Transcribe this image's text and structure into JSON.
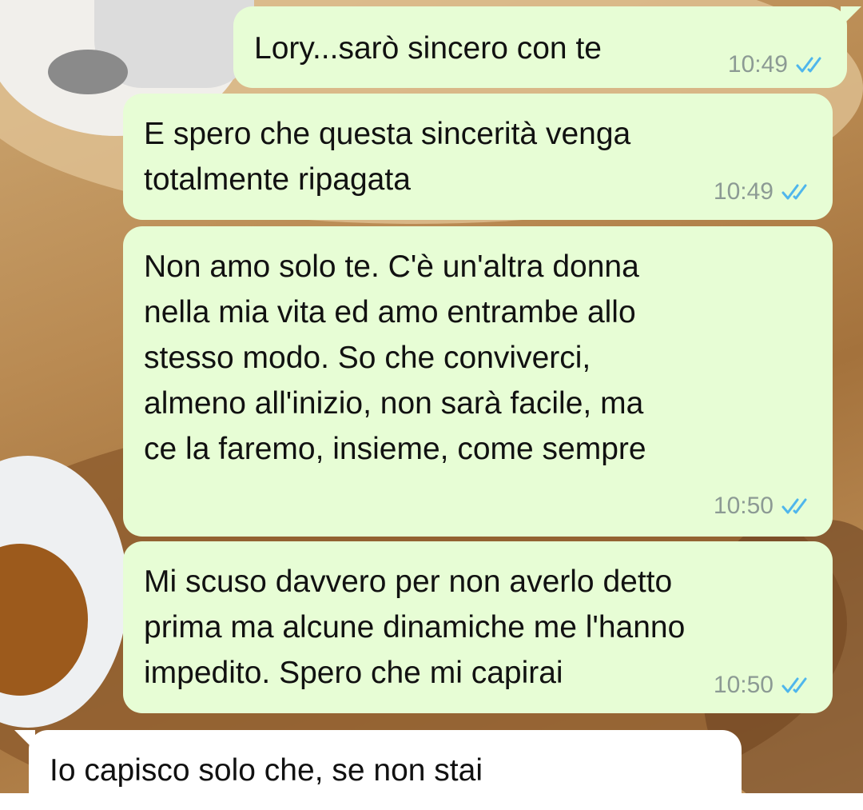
{
  "messages": [
    {
      "direction": "outgoing",
      "text": "Lory...sarò sincero con te",
      "time": "10:49",
      "status": "read"
    },
    {
      "direction": "outgoing",
      "lines": [
        "E spero che questa sincerità venga",
        "totalmente ripagata"
      ],
      "time": "10:49",
      "status": "read"
    },
    {
      "direction": "outgoing",
      "lines": [
        "Non amo solo te. C'è un'altra donna",
        "nella mia vita ed amo entrambe allo",
        "stesso modo. So che conviverci,",
        "almeno all'inizio, non sarà facile, ma",
        "ce la faremo, insieme, come sempre"
      ],
      "time": "10:50",
      "status": "read"
    },
    {
      "direction": "outgoing",
      "lines": [
        "Mi scuso davvero per non averlo detto",
        "prima ma alcune dinamiche me l'hanno",
        "impedito. Spero che mi capirai"
      ],
      "time": "10:50",
      "status": "read"
    },
    {
      "direction": "incoming",
      "text": "Io capisco solo che, se non stai"
    }
  ],
  "colors": {
    "outgoing_bubble": "#e7fdd5",
    "incoming_bubble": "#ffffff",
    "read_ticks": "#4fb6ec",
    "timestamp": "#8c9a94"
  },
  "icons": {
    "read_receipt": "double-check-icon"
  }
}
